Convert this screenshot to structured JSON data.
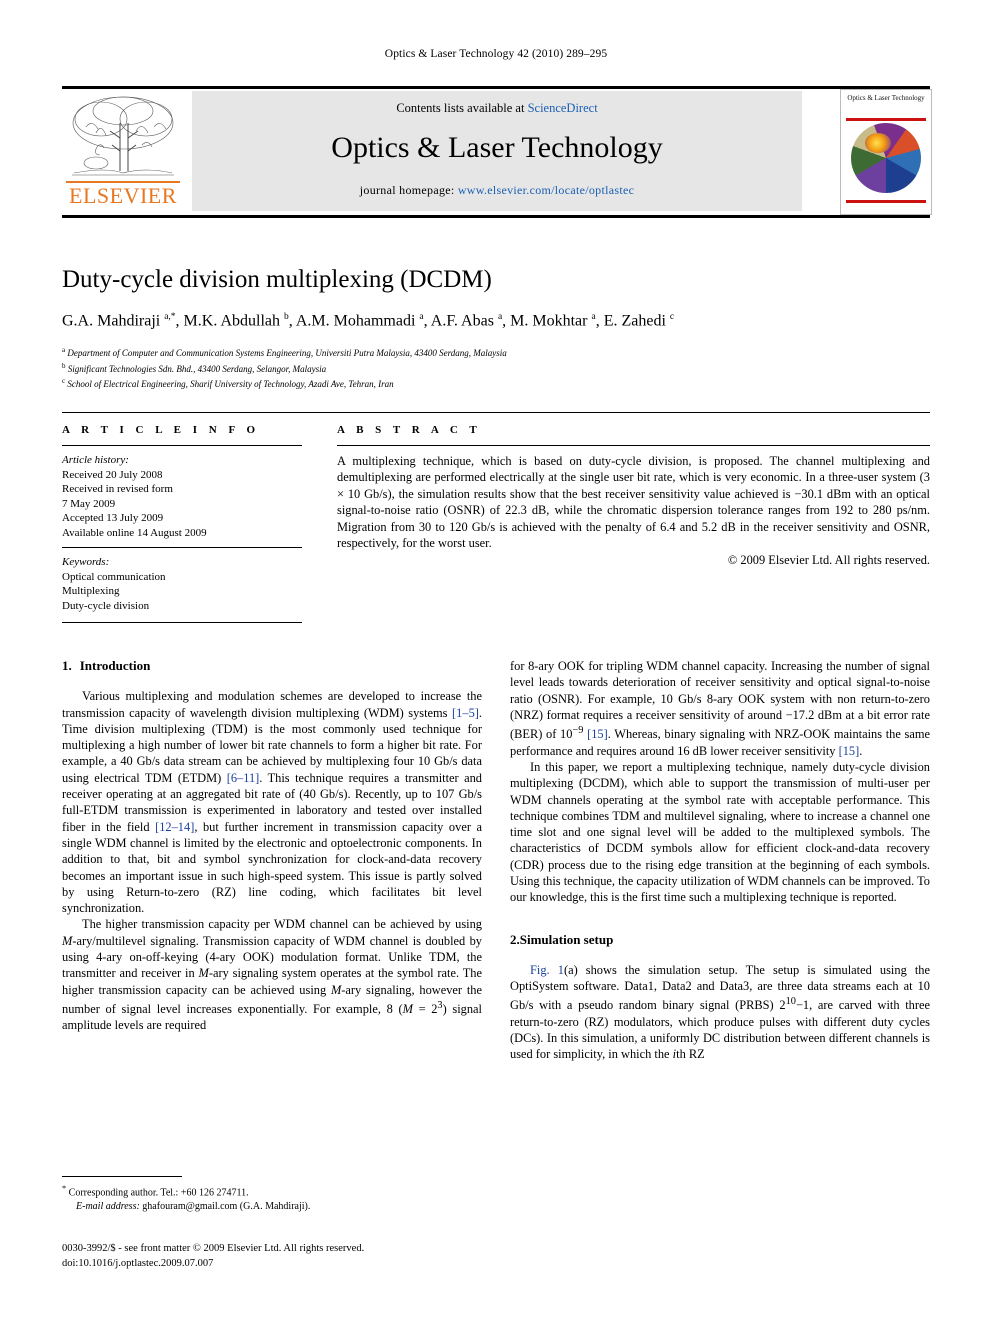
{
  "running_head": "Optics & Laser Technology 42 (2010) 289–295",
  "masthead": {
    "contents_prefix": "Contents lists available at ",
    "contents_link": "ScienceDirect",
    "journal_title": "Optics & Laser Technology",
    "homepage_prefix": "journal homepage: ",
    "homepage_url": "www.elsevier.com/locate/optlastec",
    "publisher": "ELSEVIER",
    "cover_title": "Optics & Laser Technology",
    "accent_orange": "#E87722",
    "link_blue": "#1a5fb4",
    "cover_red": "#cc1111"
  },
  "article": {
    "title": "Duty-cycle division multiplexing (DCDM)",
    "authors_html": "G.A. Mahdiraji <sup>a,*</sup>, M.K. Abdullah <sup>b</sup>, A.M. Mohammadi <sup>a</sup>, A.F. Abas <sup>a</sup>, M. Mokhtar <sup>a</sup>, E. Zahedi <sup>c</sup>",
    "affiliations": [
      "a Department of Computer and Communication Systems Engineering, Universiti Putra Malaysia, 43400 Serdang, Malaysia",
      "b Significant Technologies Sdn. Bhd., 43400 Serdang, Selangor, Malaysia",
      "c School of Electrical Engineering, Sharif University of Technology, Azadi Ave, Tehran, Iran"
    ]
  },
  "article_info": {
    "label": "A R T I C L E   I N F O",
    "history_label": "Article history:",
    "history": [
      "Received 20 July 2008",
      "Received in revised form",
      "7 May 2009",
      "Accepted 13 July 2009",
      "Available online 14 August 2009"
    ],
    "keywords_label": "Keywords:",
    "keywords": [
      "Optical communication",
      "Multiplexing",
      "Duty-cycle division"
    ]
  },
  "abstract": {
    "label": "A B S T R A C T",
    "text": "A multiplexing technique, which is based on duty-cycle division, is proposed. The channel multiplexing and demultiplexing are performed electrically at the single user bit rate, which is very economic. In a three-user system (3 × 10 Gb/s), the simulation results show that the best receiver sensitivity value achieved is −30.1 dBm with an optical signal-to-noise ratio (OSNR) of 22.3 dB, while the chromatic dispersion tolerance ranges from 192 to 280 ps/nm. Migration from 30 to 120 Gb/s is achieved with the penalty of 6.4 and 5.2 dB in the receiver sensitivity and OSNR, respectively, for the worst user.",
    "copyright": "© 2009 Elsevier Ltd. All rights reserved."
  },
  "body": {
    "section1_num": "1.",
    "section1_title": "Introduction",
    "section2_num": "2.",
    "section2_title": "Simulation setup",
    "left_para1_a": "Various multiplexing and modulation schemes are developed to increase the transmission capacity of wavelength division multiplexing (WDM) systems ",
    "left_para1_ref1": "[1–5]",
    "left_para1_b": ". Time division multiplexing (TDM) is the most commonly used technique for multiplexing a high number of lower bit rate channels to form a higher bit rate. For example, a 40 Gb/s data stream can be achieved by multiplexing four 10 Gb/s data using electrical TDM (ETDM) ",
    "left_para1_ref2": "[6–11]",
    "left_para1_c": ". This technique requires a transmitter and receiver operating at an aggregated bit rate of (40 Gb/s). Recently, up to 107 Gb/s full-ETDM transmission is experimented in laboratory and tested over installed fiber in the field ",
    "left_para1_ref3": "[12–14]",
    "left_para1_d": ", but further increment in transmission capacity over a single WDM channel is limited by the electronic and optoelectronic components. In addition to that, bit and symbol synchronization for clock-and-data recovery becomes an important issue in such high-speed system. This issue is partly solved by using Return-to-zero (RZ) line coding, which facilitates bit level synchronization.",
    "left_para2_a": "The higher transmission capacity per WDM channel can be achieved by using ",
    "left_para2_i1": "M",
    "left_para2_b": "-ary/multilevel signaling. Transmission capacity of WDM channel is doubled by using 4-ary on-off-keying (4-ary OOK) modulation format. Unlike TDM, the transmitter and receiver in ",
    "left_para2_i2": "M",
    "left_para2_c": "-ary signaling system operates at the symbol rate. The higher transmission capacity can be achieved using ",
    "left_para2_i3": "M",
    "left_para2_d": "-ary signaling, however the number of signal level increases exponentially. For example, 8 (",
    "left_para2_i4": "M",
    "left_para2_e": " = 2",
    "left_para2_sup": "3",
    "left_para2_f": ") signal amplitude levels are required",
    "right_para1_a": "for 8-ary OOK for tripling WDM channel capacity. Increasing the number of signal level leads towards deterioration of receiver sensitivity and optical signal-to-noise ratio (OSNR). For example, 10 Gb/s 8-ary OOK system with non return-to-zero (NRZ) format requires a receiver sensitivity of around −17.2 dBm at a bit error rate (BER) of 10",
    "right_para1_sup": "−9",
    "right_para1_ref1": "[15]",
    "right_para1_b": ". Whereas, binary signaling with NRZ-OOK maintains the same performance and requires around 16 dB lower receiver sensitivity ",
    "right_para1_ref2": "[15]",
    "right_para1_c": ".",
    "right_para2": "In this paper, we report a multiplexing technique, namely duty-cycle division multiplexing (DCDM), which able to support the transmission of multi-user per WDM channels operating at the symbol rate with acceptable performance. This technique combines TDM and multilevel signaling, where to increase a channel one time slot and one signal level will be added to the multiplexed symbols. The characteristics of DCDM symbols allow for efficient clock-and-data recovery (CDR) process due to the rising edge transition at the beginning of each symbols. Using this technique, the capacity utilization of WDM channels can be improved. To our knowledge, this is the first time such a multiplexing technique is reported.",
    "right_para3_ref": "Fig. 1",
    "right_para3_a": "(a) shows the simulation setup. The setup is simulated using the OptiSystem software. Data1, Data2 and Data3, are three data streams each at 10 Gb/s with a pseudo random binary signal (PRBS) 2",
    "right_para3_sup": "10",
    "right_para3_b": "−1, are carved with three return-to-zero (RZ) modulators, which produce pulses with different duty cycles (DCs). In this simulation, a uniformly DC distribution between different channels is used for simplicity, in which the ",
    "right_para3_i": "i",
    "right_para3_c": "th RZ"
  },
  "footnote": {
    "star": "*",
    "corresponding": " Corresponding author. Tel.: +60 126 274711.",
    "email_label": "E-mail address:",
    "email": " ghafouram@gmail.com (G.A. Mahdiraji)."
  },
  "footer": {
    "line1": "0030-3992/$ - see front matter © 2009 Elsevier Ltd. All rights reserved.",
    "line2": "doi:10.1016/j.optlastec.2009.07.007"
  }
}
